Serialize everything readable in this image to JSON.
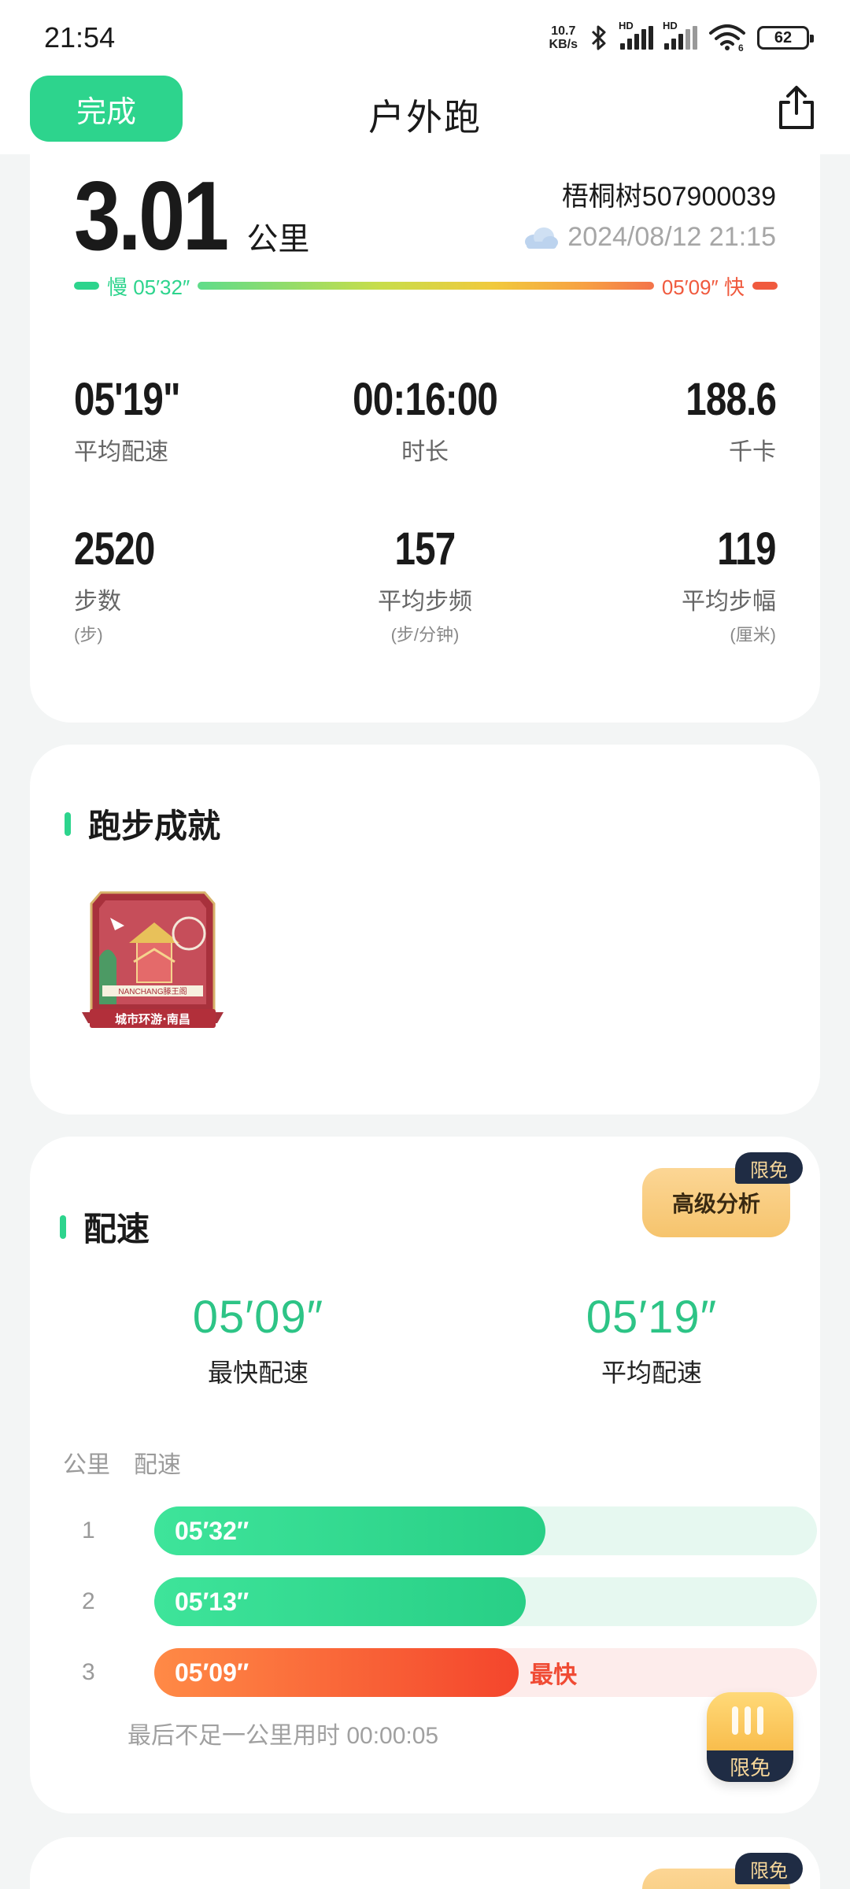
{
  "status_bar": {
    "time": "21:54",
    "net_speed_value": "10.7",
    "net_speed_unit": "KB/s",
    "signal_label_1": "HD",
    "signal_label_2": "HD",
    "wifi_sub": "6",
    "battery": "62"
  },
  "header": {
    "done_label": "完成",
    "title": "户外跑",
    "share_icon": "share-icon"
  },
  "summary": {
    "distance": "3.01",
    "distance_unit": "公里",
    "user_name": "梧桐树507900039",
    "weather_icon": "cloud-icon",
    "date": "2024/08/12 21:15",
    "slow_label": "慢 05′32″",
    "fast_label": "05′09″ 快"
  },
  "stats": [
    {
      "value": "05'19\"",
      "label": "平均配速",
      "unit": ""
    },
    {
      "value": "00:16:00",
      "label": "时长",
      "unit": ""
    },
    {
      "value": "188.6",
      "label": "千卡",
      "unit": ""
    },
    {
      "value": "2520",
      "label": "步数",
      "unit": "(步)"
    },
    {
      "value": "157",
      "label": "平均步频",
      "unit": "(步/分钟)"
    },
    {
      "value": "119",
      "label": "平均步幅",
      "unit": "(厘米)"
    }
  ],
  "achievements": {
    "title": "跑步成就",
    "badge_caption": "城市环游·南昌",
    "badge_sub": "NANCHANG滕王阁"
  },
  "pace": {
    "title": "配速",
    "advanced_label": "高级分析",
    "free_tag": "限免",
    "fastest_value": "05′09″",
    "fastest_label": "最快配速",
    "average_value": "05′19″",
    "average_label": "平均配速",
    "col_km": "公里",
    "col_pace": "配速",
    "splits": [
      {
        "km": "1",
        "pace": "05′32″",
        "fraction": 0.59,
        "fastest": false
      },
      {
        "km": "2",
        "pace": "05′13″",
        "fraction": 0.56,
        "fastest": false
      },
      {
        "km": "3",
        "pace": "05′09″",
        "fraction": 0.55,
        "fastest": true
      }
    ],
    "fastest_tag": "最快",
    "last_note": "最后不足一公里用时 00:00:05"
  },
  "floating": {
    "free_label": "限免"
  },
  "next_card": {
    "free_tag": "限免"
  },
  "colors": {
    "accent": "#2dd48d",
    "fast": "#f05a3e",
    "vip_gold": "#f6c46d",
    "vip_dark": "#1f2c44"
  }
}
